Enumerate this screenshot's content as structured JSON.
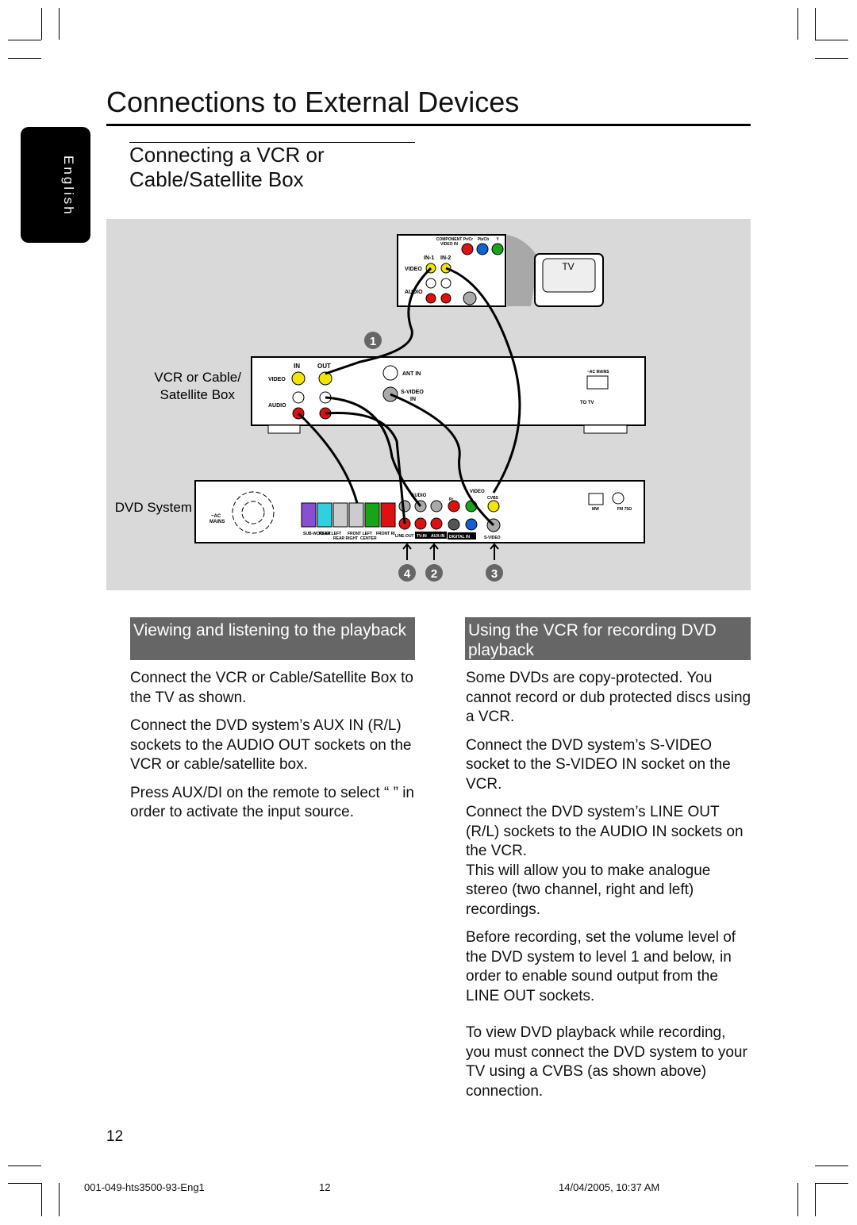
{
  "header": {
    "title": "Connections to External Devices",
    "language_tab": "English"
  },
  "section": {
    "title_line1": "Connecting a VCR or",
    "title_line2": "Cable/Satellite Box"
  },
  "diagram": {
    "tv_label": "TV",
    "vcr_label_line1": "VCR or Cable/",
    "vcr_label_line2": "Satellite Box",
    "dvd_label": "DVD System",
    "tv_panel": {
      "component": "COMPONENT",
      "video_in": "VIDEO IN",
      "pr": "Pr/Cr",
      "pb": "Pb/Cb",
      "y": "Y",
      "in1": "IN-1",
      "in2": "IN-2",
      "video": "VIDEO",
      "audio": "AUDIO"
    },
    "vcr_panel": {
      "in": "IN",
      "out": "OUT",
      "video": "VIDEO",
      "audio": "AUDIO",
      "ant_in": "ANT IN",
      "svideo": "S-VIDEO",
      "svideo_in": "IN",
      "ac_mains": "~AC MAINS",
      "to_tv": "TO TV"
    },
    "dvd_panel": {
      "ac": "~AC",
      "mains": "MAINS",
      "speakers": [
        "SUB-WOOFER",
        "REAR LEFT",
        "REAR RIGHT",
        "FRONT LEFT",
        "CENTER",
        "FRONT RIGHT"
      ],
      "line_out": "LINE-OUT",
      "tv_in": "TV-IN",
      "aux_in": "AUX-IN",
      "digital_in": "DIGITAL IN",
      "svideo": "S-VIDEO",
      "audio": "AUDIO",
      "video": "VIDEO",
      "cvbs": "CVBS",
      "pr": "Pr",
      "mw": "MW",
      "fm": "FM 75Ω"
    },
    "step_markers": [
      "1",
      "4",
      "2",
      "3"
    ],
    "colors": {
      "yellow": "#f2e600",
      "red": "#e01010",
      "white": "#ffffff",
      "green": "#19a319",
      "blue": "#1060d0",
      "panel": "#d9d9d9",
      "purple": "#8a4fd0",
      "cyan": "#30d0e0"
    }
  },
  "left": {
    "heading": "Viewing and listening to the playback",
    "paragraphs": [
      "Connect the VCR or Cable/Satellite Box to the TV as shown.",
      "Connect the DVD system’s AUX IN (R/L)  sockets to the AUDIO OUT sockets on the VCR or cable/satellite box.",
      "Press AUX/DI   on the remote to select “        ” in order to activate the input source."
    ]
  },
  "right": {
    "heading": "Using the VCR for recording DVD playback",
    "paragraphs": [
      "Some DVDs are copy-protected. You cannot record or dub protected discs using a VCR.",
      "Connect the DVD system’s S-VIDEO socket to the S-VIDEO IN socket on the VCR.",
      "Connect the DVD system’s LINE OUT (R/L)  sockets to the AUDIO IN sockets on the VCR.",
      "This will allow you to make analogue stereo (two channel, right and left) recordings.",
      "Before recording, set the volume level of the DVD system to level 1 and below, in order to enable sound output from the LINE OUT sockets.",
      "To view DVD playback while recording, you must connect the DVD system to your TV using a CVBS (as shown above) connection."
    ]
  },
  "page_number": "12",
  "footer": {
    "file": "001-049-hts3500-93-Eng1",
    "page": "12",
    "date": "14/04/2005, 10:37 AM"
  }
}
